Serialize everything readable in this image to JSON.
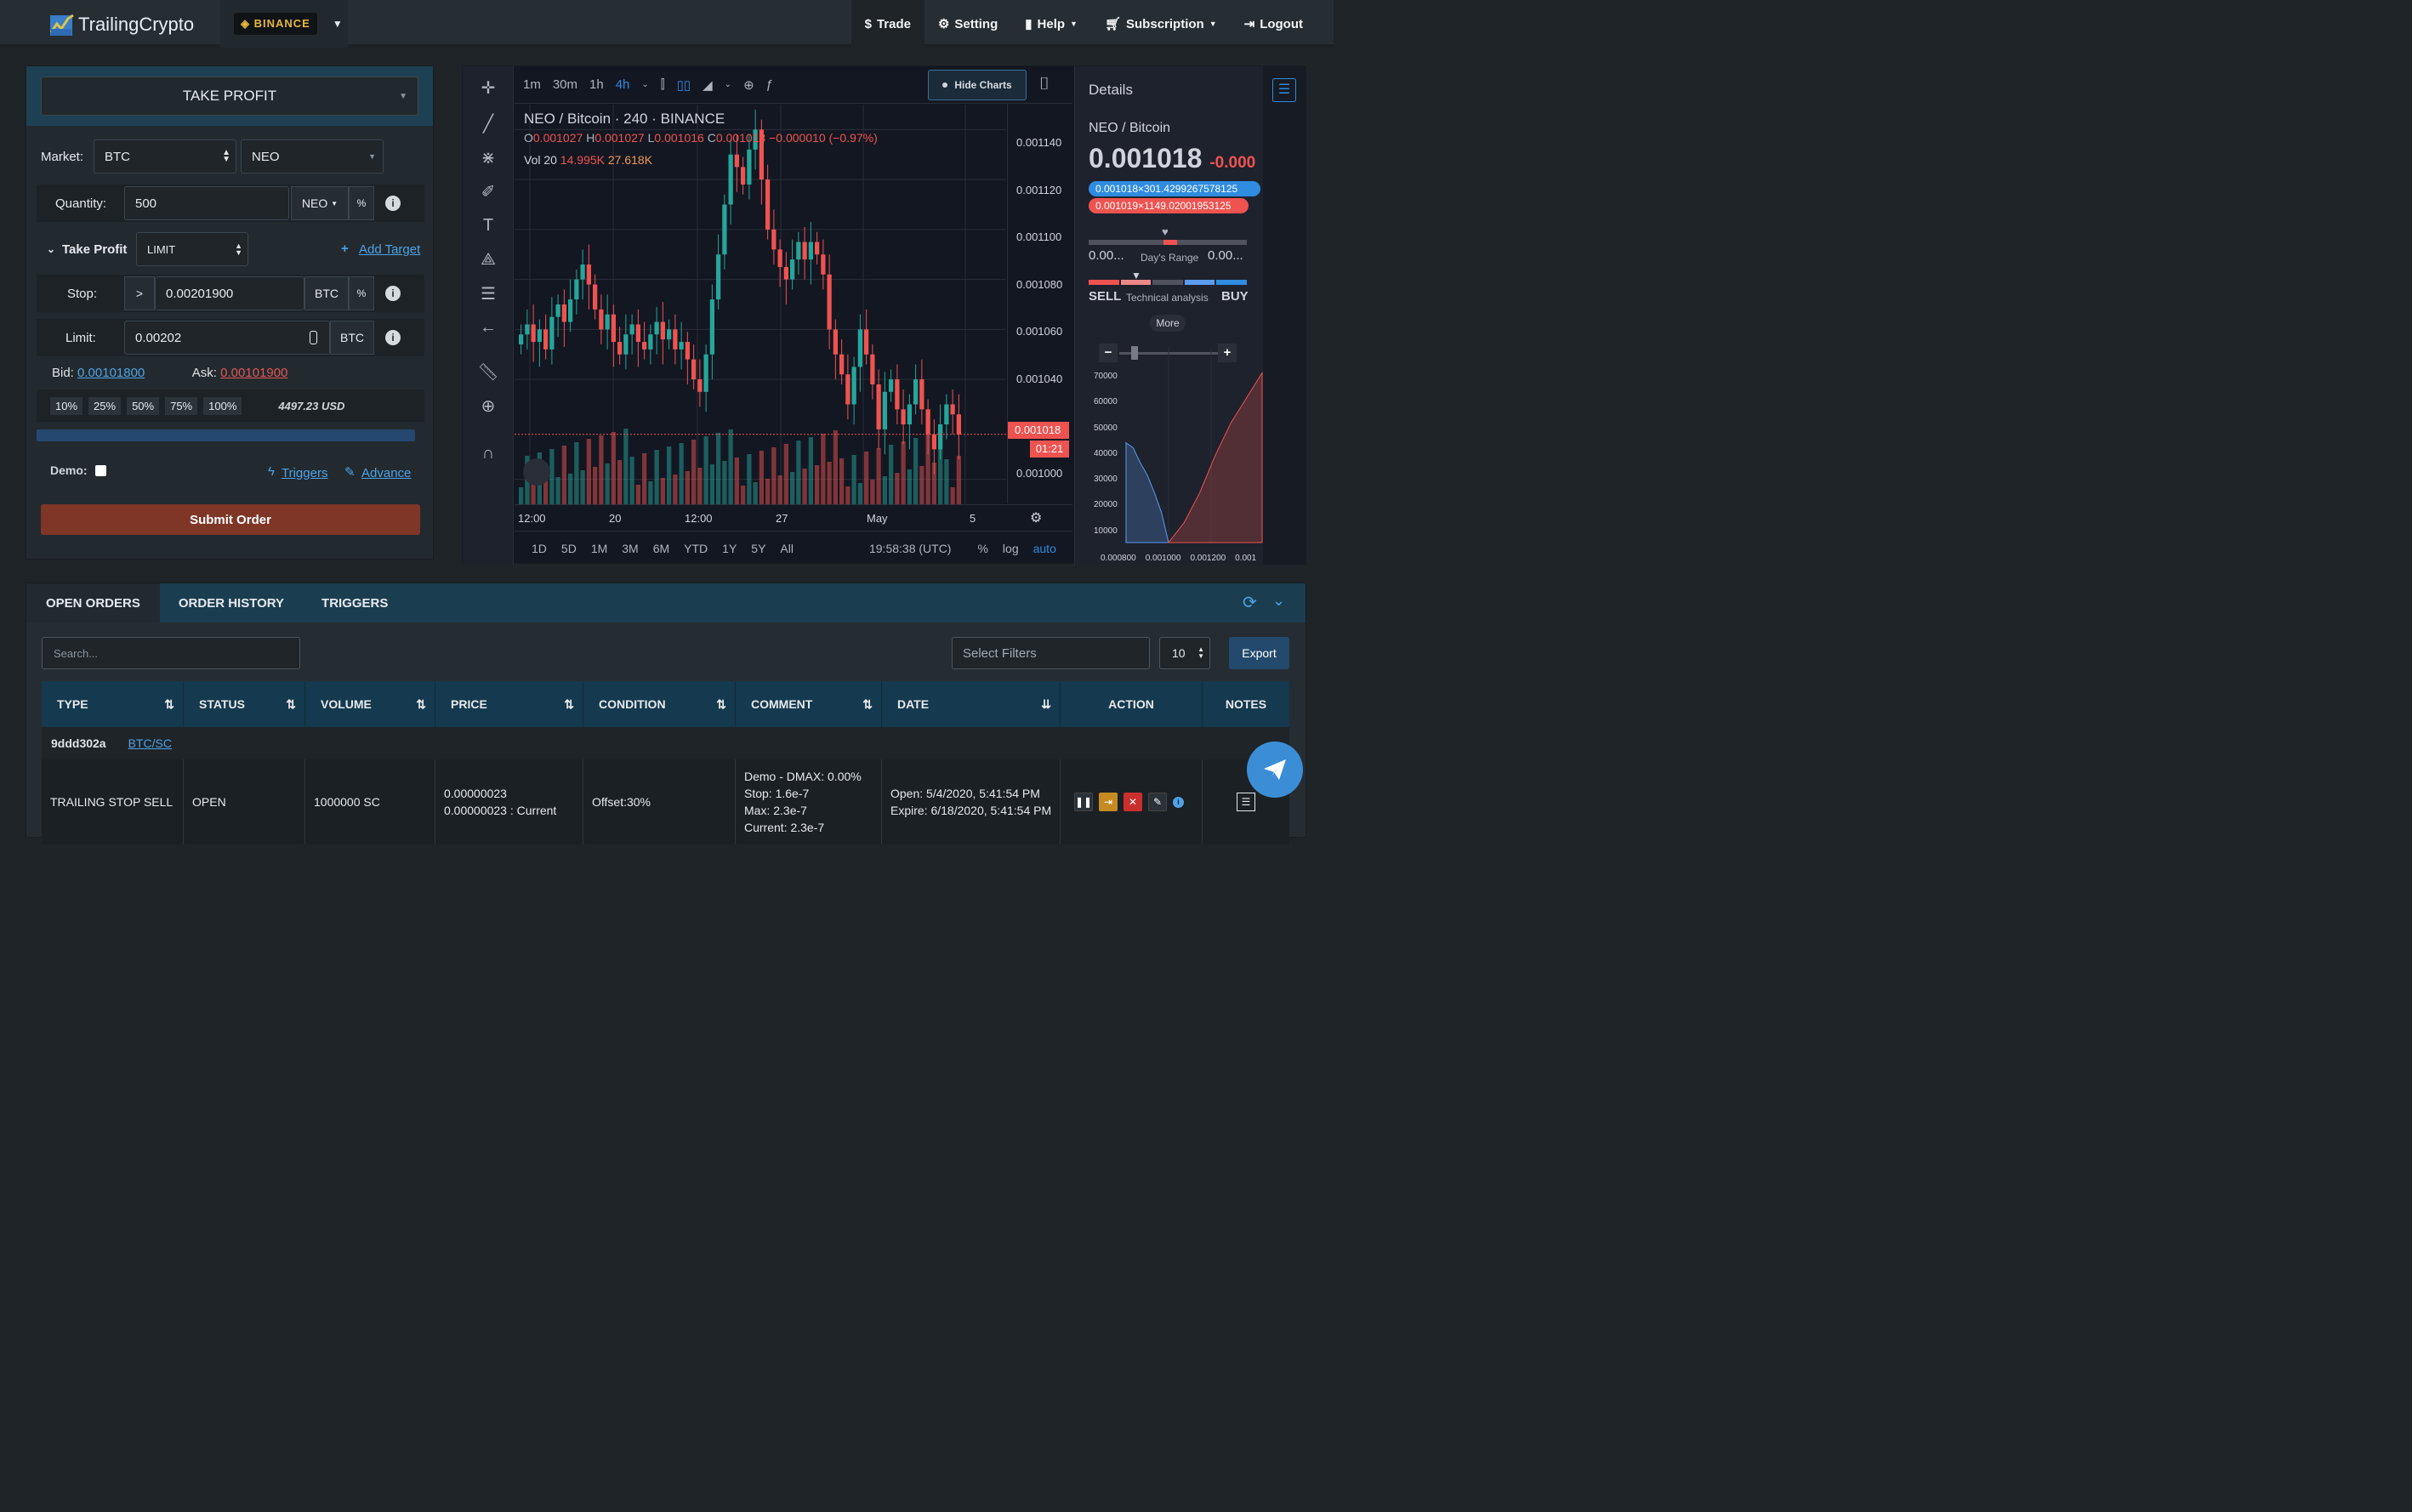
{
  "brand": {
    "name": "TrailingCrypto",
    "exchange": "BINANCE"
  },
  "nav": {
    "trade": "Trade",
    "setting": "Setting",
    "help": "Help",
    "subscription": "Subscription",
    "logout": "Logout"
  },
  "order_form": {
    "mode": "TAKE PROFIT",
    "market_label": "Market:",
    "market_base": "BTC",
    "market_quote": "NEO",
    "quantity_label": "Quantity:",
    "quantity_value": "500",
    "quantity_unit": "NEO",
    "percent": "%",
    "take_profit_label": "Take Profit",
    "take_profit_type": "LIMIT",
    "add_target": "Add Target",
    "stop_label": "Stop:",
    "stop_operator": ">",
    "stop_value": "0.00201900",
    "stop_unit": "BTC",
    "limit_label": "Limit:",
    "limit_value": "0.00202",
    "limit_unit": "BTC",
    "bid_label": "Bid:",
    "bid_value": "0.00101800",
    "ask_label": "Ask:",
    "ask_value": "0.00101900",
    "percent_buttons": [
      "10%",
      "25%",
      "50%",
      "75%",
      "100%"
    ],
    "usd_value": "4497.23 USD",
    "demo_label": "Demo:",
    "triggers": "Triggers",
    "advance": "Advance",
    "submit": "Submit Order"
  },
  "chart": {
    "intervals": [
      "1m",
      "30m",
      "1h",
      "4h"
    ],
    "hide_charts": "Hide Charts",
    "symbol_title": "NEO / Bitcoin · 240 · BINANCE",
    "ohlc": {
      "o": "0.001027",
      "h": "0.001027",
      "l": "0.001016",
      "c": "0.001018",
      "change": "−0.000010 (−0.97%)"
    },
    "vol_label": "Vol 20",
    "vol1": "14.995K",
    "vol2": "27.618K",
    "price_labels": [
      "0.001140",
      "0.001120",
      "0.001100",
      "0.001080",
      "0.001060",
      "0.001040",
      "0.001000"
    ],
    "last_price": "0.001018",
    "countdown": "01:21",
    "time_labels": [
      "12:00",
      "20",
      "12:00",
      "27",
      "May",
      "5"
    ],
    "ranges": [
      "1D",
      "5D",
      "1M",
      "3M",
      "6M",
      "YTD",
      "1Y",
      "5Y",
      "All"
    ],
    "clock": "19:58:38 (UTC)",
    "pct": "%",
    "log": "log",
    "auto": "auto",
    "chart_data": {
      "type": "candlestick",
      "ylim": [
        0.00099,
        0.00115
      ],
      "y_ticks": [
        0.00114,
        0.00112,
        0.0011,
        0.00108,
        0.00106,
        0.00104,
        0.001
      ],
      "x_ticks": [
        "12:00",
        "20",
        "12:00",
        "27",
        "May",
        "5"
      ],
      "close": [
        0.001058,
        0.001062,
        0.001055,
        0.00106,
        0.001052,
        0.001065,
        0.00107,
        0.001063,
        0.001072,
        0.00108,
        0.001086,
        0.001078,
        0.001068,
        0.00106,
        0.001066,
        0.001055,
        0.00105,
        0.001058,
        0.001062,
        0.001055,
        0.001052,
        0.001058,
        0.001063,
        0.001056,
        0.00106,
        0.001052,
        0.001055,
        0.001048,
        0.00104,
        0.001035,
        0.00105,
        0.001072,
        0.00109,
        0.00111,
        0.00113,
        0.001125,
        0.001118,
        0.001132,
        0.00114,
        0.00112,
        0.0011,
        0.001092,
        0.001085,
        0.00108,
        0.001088,
        0.001095,
        0.001088,
        0.001095,
        0.00109,
        0.001082,
        0.00106,
        0.00105,
        0.001042,
        0.00103,
        0.001045,
        0.00106,
        0.00105,
        0.001038,
        0.00102,
        0.001035,
        0.00104,
        0.001028,
        0.001022,
        0.00103,
        0.00104,
        0.001028,
        0.001018,
        0.001012,
        0.001022,
        0.00103,
        0.001026,
        0.001018
      ]
    }
  },
  "details": {
    "title": "Details",
    "pair": "NEO / Bitcoin",
    "price": "0.001018",
    "change": "-0.000",
    "bid_book": "0.001018×301.4299267578125",
    "ask_book": "0.001019×1149.02001953125",
    "day_low": "0.00...",
    "day_range": "Day's Range",
    "day_high": "0.00...",
    "sell": "SELL",
    "ta": "Technical analysis",
    "buy": "BUY",
    "more": "More",
    "depth_y": [
      "70000",
      "60000",
      "50000",
      "40000",
      "30000",
      "20000",
      "10000"
    ],
    "depth_x": [
      "0.000800",
      "0.001000",
      "0.001200",
      "0.001"
    ],
    "depth_chart": {
      "type": "area",
      "ylim": [
        0,
        75000
      ],
      "y_ticks": [
        70000,
        60000,
        50000,
        40000,
        30000,
        20000,
        10000
      ],
      "x_ticks": [
        "0.000800",
        "0.001000",
        "0.001200",
        "0.001"
      ],
      "series": [
        {
          "values": [
            40000,
            38000,
            32000,
            27000,
            20000,
            12000,
            0
          ]
        },
        {
          "values": [
            0,
            8000,
            20000,
            35000,
            48000,
            58000,
            68000
          ]
        }
      ]
    }
  },
  "orders": {
    "tabs": [
      "OPEN ORDERS",
      "ORDER HISTORY",
      "TRIGGERS"
    ],
    "search_placeholder": "Search...",
    "filters_placeholder": "Select Filters",
    "page_size": "10",
    "export": "Export",
    "columns": [
      "TYPE",
      "STATUS",
      "VOLUME",
      "PRICE",
      "CONDITION",
      "COMMENT",
      "DATE",
      "ACTION",
      "NOTES"
    ],
    "group_id": "9ddd302a",
    "group_pair": "BTC/SC",
    "row": {
      "type": "TRAILING STOP SELL",
      "status": "OPEN",
      "volume": "1000000 SC",
      "price1": "0.00000023",
      "price2": "0.00000023 : Current",
      "condition": "Offset:30%",
      "comment": [
        "Demo - DMAX: 0.00%",
        "Stop: 1.6e-7",
        "Max: 2.3e-7",
        "Current: 2.3e-7"
      ],
      "date_open": "Open: 5/4/2020, 5:41:54 PM",
      "date_expire": "Expire: 6/18/2020, 5:41:54 PM"
    }
  }
}
